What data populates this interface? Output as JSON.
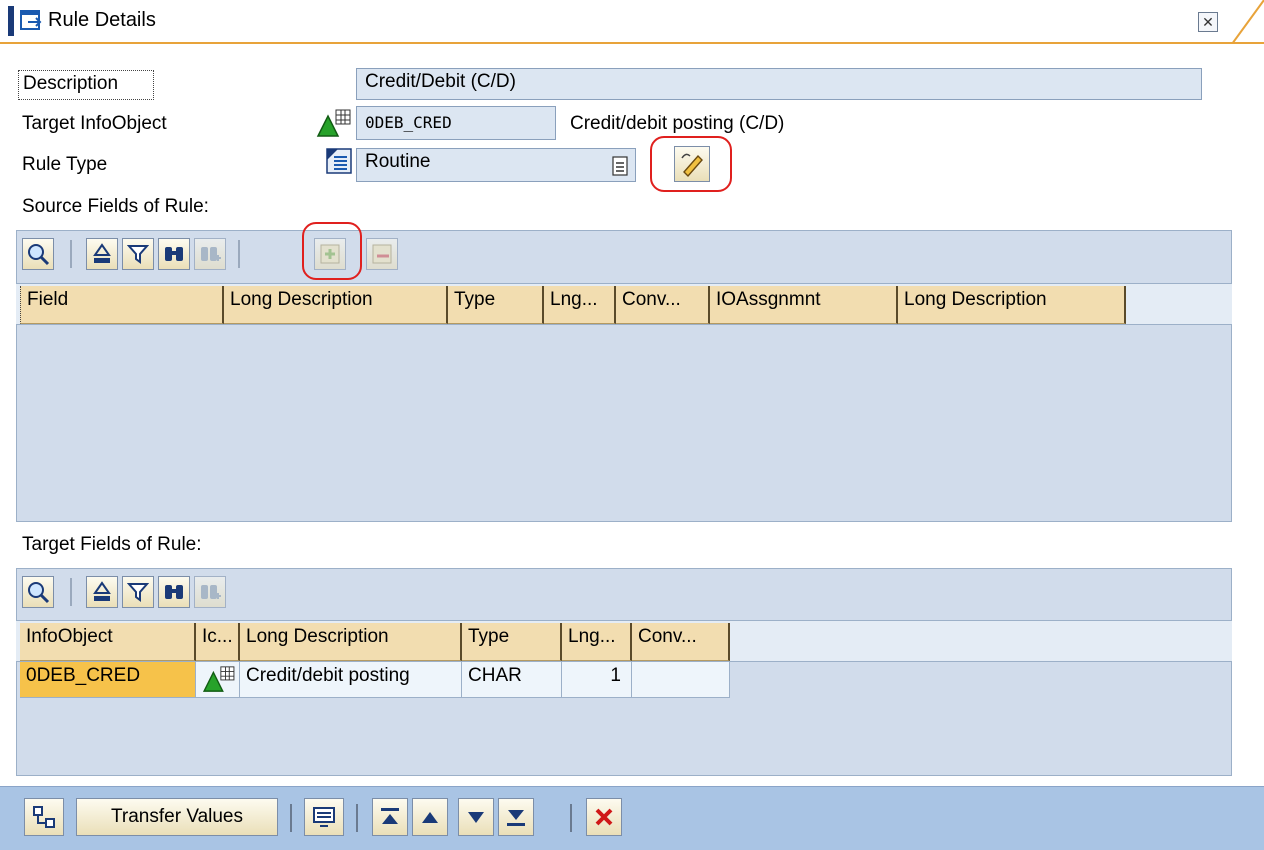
{
  "window": {
    "title": "Rule Details"
  },
  "form": {
    "description_label": "Description",
    "description_value": "Credit/Debit (C/D)",
    "target_label": "Target InfoObject",
    "target_value": "0DEB_CRED",
    "target_text": "Credit/debit posting (C/D)",
    "ruletype_label": "Rule Type",
    "ruletype_value": "Routine"
  },
  "source": {
    "heading": "Source Fields of Rule:",
    "columns": [
      "Field",
      "Long Description",
      "Type",
      "Lng...",
      "Conv...",
      "IOAssgnmnt",
      "Long Description"
    ]
  },
  "target": {
    "heading": "Target Fields of Rule:",
    "columns": [
      "InfoObject",
      "Ic...",
      "Long Description",
      "Type",
      "Lng...",
      "Conv..."
    ],
    "rows": [
      {
        "infoobject": "0DEB_CRED",
        "long_description": "Credit/debit posting",
        "type": "CHAR",
        "lng": "1",
        "conv": ""
      }
    ]
  },
  "bottom": {
    "transfer_label": "Transfer Values"
  },
  "icons": {
    "title": "dialog-icon",
    "close": "close-icon",
    "infoobject": "infoobject-icon",
    "ruletype": "rule-type-icon",
    "dropdown": "dropdown-icon",
    "edit_routine": "edit-routine-icon",
    "details": "details-icon",
    "sort": "sort-icon",
    "filter": "filter-icon",
    "find": "find-icon",
    "find_next": "find-next-icon",
    "insert_row": "insert-row-icon",
    "delete_row": "delete-row-icon",
    "hierarchy": "hierarchy-icon",
    "screen": "screen-icon",
    "first": "first-page-icon",
    "up": "page-up-icon",
    "down": "page-down-icon",
    "last": "last-page-icon",
    "cancel": "cancel-icon"
  },
  "colors": {
    "panel": "#d1dceb",
    "header": "#f2ddb0",
    "highlight": "#f6c24a",
    "bottom": "#a9c4e4",
    "red": "#e0201e"
  }
}
